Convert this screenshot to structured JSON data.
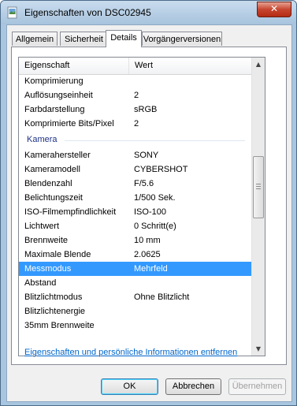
{
  "window": {
    "title": "Eigenschaften von DSC02945",
    "close_glyph": "✕"
  },
  "tabs": [
    {
      "label": "Allgemein",
      "active": false
    },
    {
      "label": "Sicherheit",
      "active": false
    },
    {
      "label": "Details",
      "active": true
    },
    {
      "label": "Vorgängerversionen",
      "active": false
    }
  ],
  "list": {
    "header_property": "Eigenschaft",
    "header_value": "Wert",
    "rows": [
      {
        "name": "Komprimierung",
        "value": ""
      },
      {
        "name": "Auflösungseinheit",
        "value": "2"
      },
      {
        "name": "Farbdarstellung",
        "value": "sRGB"
      },
      {
        "name": "Komprimierte Bits/Pixel",
        "value": "2"
      }
    ],
    "group_label": "Kamera",
    "camera_rows": [
      {
        "name": "Kamerahersteller",
        "value": "SONY"
      },
      {
        "name": "Kameramodell",
        "value": "CYBERSHOT"
      },
      {
        "name": "Blendenzahl",
        "value": "F/5.6"
      },
      {
        "name": "Belichtungszeit",
        "value": "1/500 Sek."
      },
      {
        "name": "ISO-Filmempfindlichkeit",
        "value": "ISO-100"
      },
      {
        "name": "Lichtwert",
        "value": "0 Schritt(e)"
      },
      {
        "name": "Brennweite",
        "value": "10 mm"
      },
      {
        "name": "Maximale Blende",
        "value": "2.0625"
      },
      {
        "name": "Messmodus",
        "value": "Mehrfeld",
        "selected": true
      },
      {
        "name": "Abstand",
        "value": ""
      },
      {
        "name": "Blitzlichtmodus",
        "value": "Ohne Blitzlicht"
      },
      {
        "name": "Blitzlichtenergie",
        "value": ""
      },
      {
        "name": "35mm Brennweite",
        "value": ""
      }
    ],
    "scroll_up_glyph": "▲",
    "scroll_down_glyph": "▼"
  },
  "remove_link": "Eigenschaften und persönliche Informationen entfernen",
  "buttons": {
    "ok": "OK",
    "cancel": "Abbrechen",
    "apply": "Übernehmen"
  },
  "colors": {
    "selection": "#3399ff",
    "link": "#0066cc",
    "group_header": "#1e3287"
  }
}
